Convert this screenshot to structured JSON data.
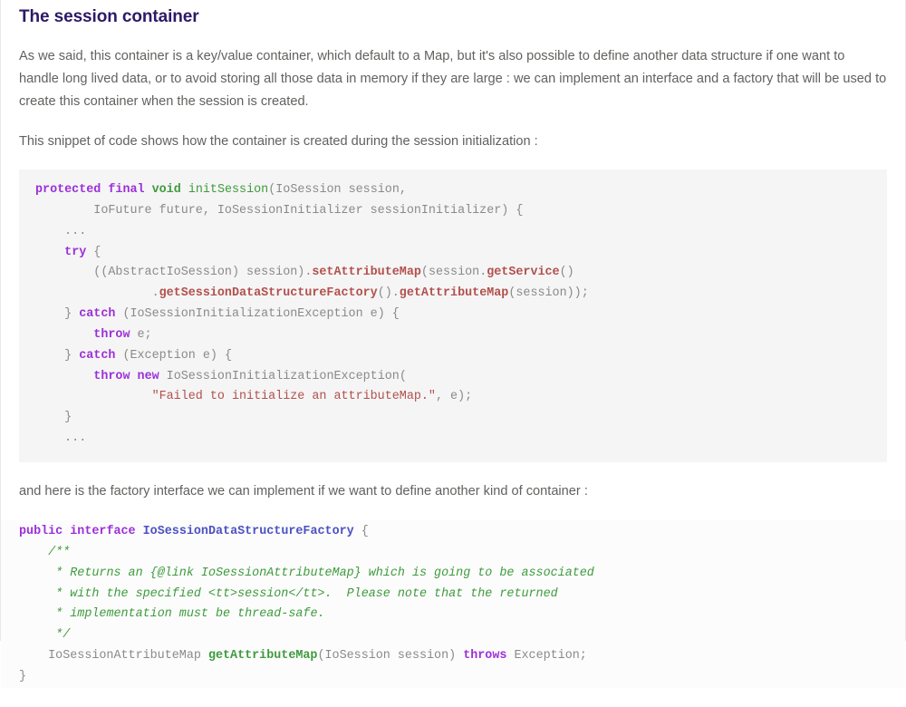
{
  "document": {
    "heading": "The session container",
    "paragraphs": [
      "As we said, this container is a key/value container, which default to a Map, but it's also possible to define another data structure if one want to handle long lived data, or to avoid storing all those data in memory if they are large : we can implement an interface and a factory that will be used to create this container when the session is created.",
      "This snippet of code shows how the container is created during the session initialization :",
      "and here is the factory interface we can implement if we want to define another kind of container :"
    ],
    "code_blocks": [
      {
        "language": "java",
        "style": "boxed-gray",
        "text": "protected final void initSession(IoSession session,\n        IoFuture future, IoSessionInitializer sessionInitializer) {\n    ...\n    try {\n        ((AbstractIoSession) session).setAttributeMap(session.getService()\n                .getSessionDataStructureFactory().getAttributeMap(session));\n    } catch (IoSessionInitializationException e) {\n        throw e;\n    } catch (Exception e) {\n        throw new IoSessionInitializationException(\n                \"Failed to initialize an attributeMap.\", e);\n    }\n    ..."
      },
      {
        "language": "java",
        "style": "plain",
        "text": "public interface IoSessionDataStructureFactory {\n    /**\n     * Returns an {@link IoSessionAttributeMap} which is going to be associated\n     * with the specified <tt>session</tt>.  Please note that the returned\n     * implementation must be thread-safe.\n     */\n    IoSessionAttributeMap getAttributeMap(IoSession session) throws Exception;\n}"
      }
    ],
    "colors": {
      "heading": "#2b1a66",
      "body_text": "#61615f",
      "code_plain": "#8a8a8a",
      "keyword": "#9b30d9",
      "type_or_function": "#3e9b3e",
      "method_call": "#b2504d",
      "string_literal": "#b2504d",
      "class_name": "#4b51c4",
      "comment": "#3e9b3e",
      "code_background": "#f5f5f5",
      "page_background": "#ffffff"
    }
  }
}
